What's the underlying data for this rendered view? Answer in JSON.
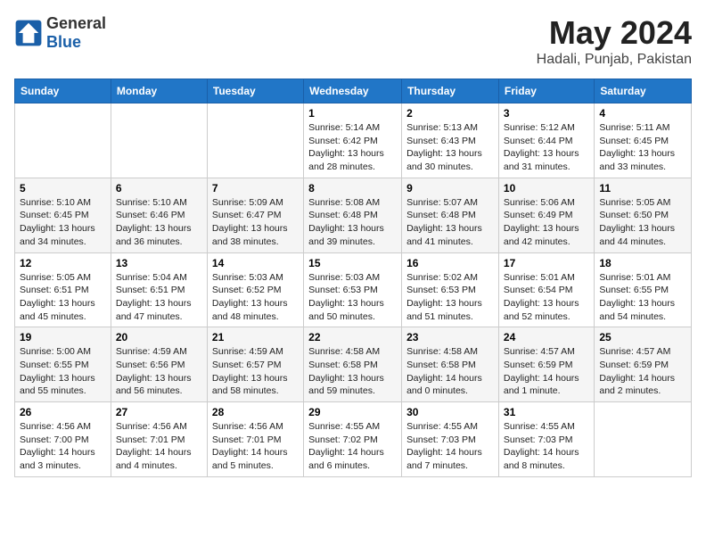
{
  "header": {
    "logo_general": "General",
    "logo_blue": "Blue",
    "title": "May 2024",
    "subtitle": "Hadali, Punjab, Pakistan"
  },
  "days_of_week": [
    "Sunday",
    "Monday",
    "Tuesday",
    "Wednesday",
    "Thursday",
    "Friday",
    "Saturday"
  ],
  "weeks": [
    [
      {
        "day": "",
        "info": ""
      },
      {
        "day": "",
        "info": ""
      },
      {
        "day": "",
        "info": ""
      },
      {
        "day": "1",
        "info": "Sunrise: 5:14 AM\nSunset: 6:42 PM\nDaylight: 13 hours\nand 28 minutes."
      },
      {
        "day": "2",
        "info": "Sunrise: 5:13 AM\nSunset: 6:43 PM\nDaylight: 13 hours\nand 30 minutes."
      },
      {
        "day": "3",
        "info": "Sunrise: 5:12 AM\nSunset: 6:44 PM\nDaylight: 13 hours\nand 31 minutes."
      },
      {
        "day": "4",
        "info": "Sunrise: 5:11 AM\nSunset: 6:45 PM\nDaylight: 13 hours\nand 33 minutes."
      }
    ],
    [
      {
        "day": "5",
        "info": "Sunrise: 5:10 AM\nSunset: 6:45 PM\nDaylight: 13 hours\nand 34 minutes."
      },
      {
        "day": "6",
        "info": "Sunrise: 5:10 AM\nSunset: 6:46 PM\nDaylight: 13 hours\nand 36 minutes."
      },
      {
        "day": "7",
        "info": "Sunrise: 5:09 AM\nSunset: 6:47 PM\nDaylight: 13 hours\nand 38 minutes."
      },
      {
        "day": "8",
        "info": "Sunrise: 5:08 AM\nSunset: 6:48 PM\nDaylight: 13 hours\nand 39 minutes."
      },
      {
        "day": "9",
        "info": "Sunrise: 5:07 AM\nSunset: 6:48 PM\nDaylight: 13 hours\nand 41 minutes."
      },
      {
        "day": "10",
        "info": "Sunrise: 5:06 AM\nSunset: 6:49 PM\nDaylight: 13 hours\nand 42 minutes."
      },
      {
        "day": "11",
        "info": "Sunrise: 5:05 AM\nSunset: 6:50 PM\nDaylight: 13 hours\nand 44 minutes."
      }
    ],
    [
      {
        "day": "12",
        "info": "Sunrise: 5:05 AM\nSunset: 6:51 PM\nDaylight: 13 hours\nand 45 minutes."
      },
      {
        "day": "13",
        "info": "Sunrise: 5:04 AM\nSunset: 6:51 PM\nDaylight: 13 hours\nand 47 minutes."
      },
      {
        "day": "14",
        "info": "Sunrise: 5:03 AM\nSunset: 6:52 PM\nDaylight: 13 hours\nand 48 minutes."
      },
      {
        "day": "15",
        "info": "Sunrise: 5:03 AM\nSunset: 6:53 PM\nDaylight: 13 hours\nand 50 minutes."
      },
      {
        "day": "16",
        "info": "Sunrise: 5:02 AM\nSunset: 6:53 PM\nDaylight: 13 hours\nand 51 minutes."
      },
      {
        "day": "17",
        "info": "Sunrise: 5:01 AM\nSunset: 6:54 PM\nDaylight: 13 hours\nand 52 minutes."
      },
      {
        "day": "18",
        "info": "Sunrise: 5:01 AM\nSunset: 6:55 PM\nDaylight: 13 hours\nand 54 minutes."
      }
    ],
    [
      {
        "day": "19",
        "info": "Sunrise: 5:00 AM\nSunset: 6:55 PM\nDaylight: 13 hours\nand 55 minutes."
      },
      {
        "day": "20",
        "info": "Sunrise: 4:59 AM\nSunset: 6:56 PM\nDaylight: 13 hours\nand 56 minutes."
      },
      {
        "day": "21",
        "info": "Sunrise: 4:59 AM\nSunset: 6:57 PM\nDaylight: 13 hours\nand 58 minutes."
      },
      {
        "day": "22",
        "info": "Sunrise: 4:58 AM\nSunset: 6:58 PM\nDaylight: 13 hours\nand 59 minutes."
      },
      {
        "day": "23",
        "info": "Sunrise: 4:58 AM\nSunset: 6:58 PM\nDaylight: 14 hours\nand 0 minutes."
      },
      {
        "day": "24",
        "info": "Sunrise: 4:57 AM\nSunset: 6:59 PM\nDaylight: 14 hours\nand 1 minute."
      },
      {
        "day": "25",
        "info": "Sunrise: 4:57 AM\nSunset: 6:59 PM\nDaylight: 14 hours\nand 2 minutes."
      }
    ],
    [
      {
        "day": "26",
        "info": "Sunrise: 4:56 AM\nSunset: 7:00 PM\nDaylight: 14 hours\nand 3 minutes."
      },
      {
        "day": "27",
        "info": "Sunrise: 4:56 AM\nSunset: 7:01 PM\nDaylight: 14 hours\nand 4 minutes."
      },
      {
        "day": "28",
        "info": "Sunrise: 4:56 AM\nSunset: 7:01 PM\nDaylight: 14 hours\nand 5 minutes."
      },
      {
        "day": "29",
        "info": "Sunrise: 4:55 AM\nSunset: 7:02 PM\nDaylight: 14 hours\nand 6 minutes."
      },
      {
        "day": "30",
        "info": "Sunrise: 4:55 AM\nSunset: 7:03 PM\nDaylight: 14 hours\nand 7 minutes."
      },
      {
        "day": "31",
        "info": "Sunrise: 4:55 AM\nSunset: 7:03 PM\nDaylight: 14 hours\nand 8 minutes."
      },
      {
        "day": "",
        "info": ""
      }
    ]
  ]
}
